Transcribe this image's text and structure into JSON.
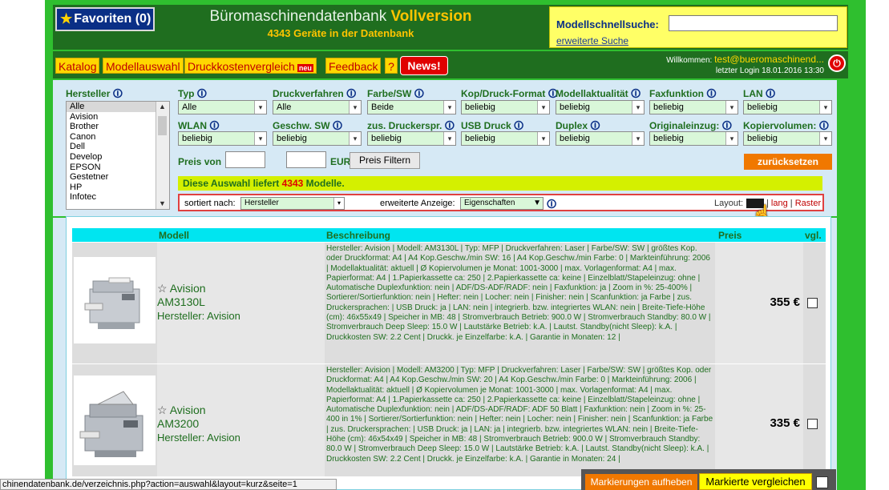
{
  "header": {
    "favorites": "Favoriten (0)",
    "title_main": "Büromaschinendatenbank",
    "title_badge": "Vollversion",
    "subtitle": "4343 Geräte in der Datenbank"
  },
  "quick_search": {
    "label": "Modellschnellsuche:",
    "value": "",
    "advanced_link": "erweiterte Suche"
  },
  "nav": {
    "items": [
      "Katalog",
      "Modellauswahl",
      "Druckkostenvergleich",
      "Feedback"
    ],
    "new_badge": "neu",
    "help": "?",
    "news": "News!"
  },
  "user": {
    "welcome": "Willkommen:",
    "email": "test@bueromaschinend...",
    "last_login": "letzter Login 18.01.2016 13:30"
  },
  "filter": {
    "hersteller_label": "Hersteller",
    "info_glyph": "🛈",
    "hersteller_list": [
      "Alle",
      "Avision",
      "Brother",
      "Canon",
      "Dell",
      "Develop",
      "EPSON",
      "Gestetner",
      "HP",
      "Infotec"
    ],
    "fields": [
      {
        "label": "Typ",
        "value": "Alle"
      },
      {
        "label": "Druckverfahren",
        "value": "Alle"
      },
      {
        "label": "Farbe/SW",
        "value": "Beide"
      },
      {
        "label": "Kop/Druck-Format",
        "value": "beliebig"
      },
      {
        "label": "Modellaktualität",
        "value": "beliebig"
      },
      {
        "label": "Faxfunktion",
        "value": "beliebig"
      },
      {
        "label": "LAN",
        "value": "beliebig"
      },
      {
        "label": "WLAN",
        "value": "beliebig"
      },
      {
        "label": "Geschw. SW",
        "value": "beliebig"
      },
      {
        "label": "zus. Druckerspr.",
        "value": "beliebig"
      },
      {
        "label": "USB Druck",
        "value": "beliebig"
      },
      {
        "label": "Duplex",
        "value": "beliebig"
      },
      {
        "label": "Originaleinzug:",
        "value": "beliebig"
      },
      {
        "label": "Kopiervolumen:",
        "value": "beliebig"
      }
    ],
    "price_from": "Preis von",
    "price_to": "bis",
    "currency": "EUR",
    "filter_button": "Preis Filtern",
    "reset_button": "zurücksetzen",
    "result_prefix": "Diese Auswahl liefert",
    "result_count": "4343",
    "result_suffix": "Modelle.",
    "sort_label": "sortiert nach:",
    "sort_value": "Hersteller",
    "ext_label": "erweiterte Anzeige:",
    "ext_value": "Eigenschaften",
    "layout_label": "Layout:",
    "layout_lang": "lang",
    "layout_raster": "Raster",
    "layout_sep": "|"
  },
  "table": {
    "headers": [
      "Modell",
      "Beschreibung",
      "Preis",
      "vgl."
    ],
    "rows": [
      {
        "brand": "Avision",
        "model": "AM3130L",
        "hersteller": "Hersteller: Avision",
        "price": "355 €",
        "description": "Hersteller: Avision | Modell: AM3130L | Typ: MFP | Druckverfahren: Laser | Farbe/SW: SW | größtes Kop. oder Druckformat: A4 | A4 Kop.Geschw./min SW: 16 | A4 Kop.Geschw./min Farbe: 0 | Markteinführung: 2006 | Modellaktualität: aktuell | Ø Kopiervolumen je Monat: 1001-3000 | max. Vorlagenformat: A4 | max. Papierformat: A4 | 1.Papierkassette ca: 250 | 2.Papierkassette ca: keine | Einzelblatt/Stapeleinzug: ohne | Automatische Duplexfunktion: nein | ADF/DS-ADF/RADF: nein | Faxfunktion: ja | Zoom in %: 25-400% | Sortierer/Sortierfunktion: nein | Hefter: nein | Locher: nein | Finisher: nein | Scanfunktion: ja Farbe | zus. Druckersprachen: | USB Druck: ja | LAN: nein | integrierb. bzw. integriertes WLAN: nein | Breite-Tiefe-Höhe (cm): 46x55x49 | Speicher in MB: 48 | Stromverbrauch Betrieb: 900.0 W | Stromverbrauch Standby: 80.0 W | Stromverbrauch Deep Sleep: 15.0 W | Lautstärke Betrieb: k.A. | Lautst. Standby(nicht Sleep): k.A. | Druckkosten SW: 2.2 Cent | Druckk. je Einzelfarbe: k.A. | Garantie in Monaten: 12 |"
      },
      {
        "brand": "Avision",
        "model": "AM3200",
        "hersteller": "Hersteller: Avision",
        "price": "335 €",
        "description": "Hersteller: Avision | Modell: AM3200 | Typ: MFP | Druckverfahren: Laser | Farbe/SW: SW | größtes Kop. oder Druckformat: A4 | A4 Kop.Geschw./min SW: 20 | A4 Kop.Geschw./min Farbe: 0 | Markteinführung: 2006 | Modellaktualität: aktuell | Ø Kopiervolumen je Monat: 1001-3000 | max. Vorlagenformat: A4 | max. Papierformat: A4 | 1.Papierkassette ca: 250 | 2.Papierkassette ca: keine | Einzelblatt/Stapeleinzug: ohne | Automatische Duplexfunktion: nein | ADF/DS-ADF/RADF: ADF 50 Blatt | Faxfunktion: nein | Zoom in %: 25-400 in 1% | Sortierer/Sortierfunktion: nein | Hefter: nein | Locher: nein | Finisher: nein | Scanfunktion: ja Farbe | zus. Druckersprachen: | USB Druck: ja | LAN: ja | integrierb. bzw. integriertes WLAN: nein | Breite-Tiefe-Höhe (cm): 46x54x49 | Speicher in MB: 48 | Stromverbrauch Betrieb: 900.0 W | Stromverbrauch Standby: 80.0 W | Stromverbrauch Deep Sleep: 15.0 W | Lautstärke Betrieb: k.A. | Lautst. Standby(nicht Sleep): k.A. | Druckkosten SW: 2.2 Cent | Druckk. je Einzelfarbe: k.A. | Garantie in Monaten: 24 |"
      }
    ]
  },
  "bottom": {
    "mark_remove": "Markierungen aufheben",
    "compare": "Markierte vergleichen"
  },
  "status_url": "chinendatenbank.de/verzeichnis.php?action=auswahl&layout=kurz&seite=1",
  "colors": {
    "page_green": "#2fbf2f",
    "header_dark_green": "#1f6e1f",
    "accent_yellow": "#ffd700",
    "accent_orange": "#f07800",
    "table_header_cyan": "#00e5f0"
  }
}
